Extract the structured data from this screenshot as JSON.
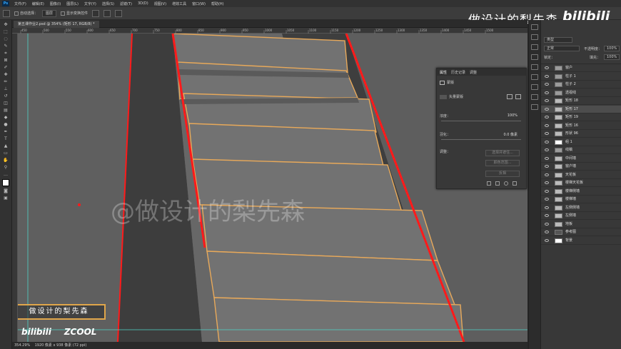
{
  "app": {
    "logo": "Ps"
  },
  "menu": [
    "文件(F)",
    "编辑(E)",
    "图像(I)",
    "图层(L)",
    "文字(Y)",
    "选择(S)",
    "滤镜(T)",
    "3D(D)",
    "视图(V)",
    "增效工具",
    "窗口(W)",
    "帮助(H)"
  ],
  "options": {
    "auto_select_label": "自动选择：",
    "auto_select_value": "图层",
    "show_transform": "显示变换控件"
  },
  "overlay": {
    "title": "做设计的梨先森",
    "bilibili": "bilibili",
    "canvas_watermark": "@做设计的梨先森",
    "brand_box": "做设计的梨先森",
    "brand_bili": "bilibili",
    "brand_zcool": "ZCOOL"
  },
  "document": {
    "tab_title": "第五课作业2.psd @ 354% (矩形 17, RGB/8) *",
    "zoom": "354.29%",
    "doc_size": "1920 像素 x 938 像素 (72 ppi)"
  },
  "properties": {
    "tabs": [
      "属性",
      "历史记录",
      "调整"
    ],
    "type_label": "蒙版",
    "mask_label": "矢量蒙版",
    "density_label": "浓度：",
    "density_value": "100%",
    "feather_label": "羽化：",
    "feather_value": "0.0 像素",
    "adjust_label": "调整：",
    "btn_select_subject": "选择并遮住...",
    "btn_color_range": "颜色范围...",
    "btn_invert": "反相"
  },
  "layers_panel": {
    "kind": "类型",
    "blend": "正常",
    "opacity_label": "不透明度：",
    "opacity_value": "100%",
    "lock_label": "锁定：",
    "fill_label": "填充：",
    "fill_value": "100%",
    "items": [
      {
        "name": "窗户",
        "thumb": "folder",
        "selected": false
      },
      {
        "name": "柱子 1",
        "thumb": "folder",
        "selected": false
      },
      {
        "name": "柱子 2",
        "thumb": "folder",
        "selected": false
      },
      {
        "name": "透视线",
        "thumb": "folder",
        "selected": false
      },
      {
        "name": "矩形 18",
        "thumb": "plain",
        "selected": false
      },
      {
        "name": "矩形 17",
        "thumb": "plain",
        "selected": true
      },
      {
        "name": "矩形 19",
        "thumb": "plain",
        "selected": false
      },
      {
        "name": "矩形 16",
        "thumb": "plain",
        "selected": false
      },
      {
        "name": "形状 96",
        "thumb": "plain",
        "selected": false
      },
      {
        "name": "组 1",
        "thumb": "white",
        "selected": false
      },
      {
        "name": "线稿",
        "thumb": "folder",
        "selected": false
      },
      {
        "name": "中间墙",
        "thumb": "plain",
        "selected": false
      },
      {
        "name": "窗户墙",
        "thumb": "plain",
        "selected": false
      },
      {
        "name": "天花板",
        "thumb": "plain",
        "selected": false
      },
      {
        "name": "楼梯天花板",
        "thumb": "plain",
        "selected": false
      },
      {
        "name": "楼梯侧墙",
        "thumb": "plain",
        "selected": false
      },
      {
        "name": "楼梯墙",
        "thumb": "plain",
        "selected": false
      },
      {
        "name": "左侧侧墙",
        "thumb": "plain",
        "selected": false
      },
      {
        "name": "左侧墙",
        "thumb": "plain",
        "selected": false
      },
      {
        "name": "地板",
        "thumb": "plain",
        "selected": false
      },
      {
        "name": "参考图",
        "thumb": "dark",
        "selected": false
      },
      {
        "name": "背景",
        "thumb": "white",
        "selected": false
      }
    ]
  },
  "ruler_ticks": [
    "450",
    "500",
    "550",
    "600",
    "650",
    "700",
    "750",
    "800",
    "850",
    "900",
    "950",
    "1000",
    "1050",
    "1100",
    "1150",
    "1200",
    "1250",
    "1300",
    "1350",
    "1400",
    "1450",
    "1500"
  ],
  "colors": {
    "accent_outline": "#e8a95a",
    "perspective_line": "#ff1a1a",
    "wall_dark": "#3d3d3d",
    "wall_mid": "#646464",
    "step": "#727272"
  },
  "icons": [
    "move-icon",
    "marquee-icon",
    "lasso-icon",
    "crop-icon",
    "eyedropper-icon",
    "brush-icon",
    "eraser-icon",
    "gradient-icon",
    "text-icon",
    "pen-icon",
    "shape-icon",
    "hand-icon",
    "zoom-icon",
    "eye-icon",
    "lock-icon"
  ]
}
